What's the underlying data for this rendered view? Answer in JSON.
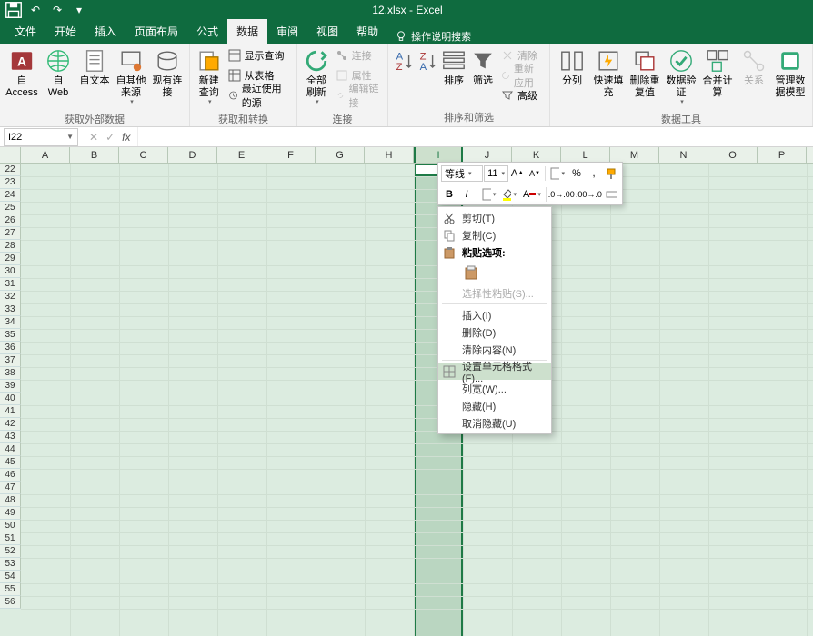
{
  "title": "12.xlsx  -  Excel",
  "qat": {
    "save": "💾",
    "undo": "↶",
    "redo": "↷"
  },
  "tabs": [
    "文件",
    "开始",
    "插入",
    "页面布局",
    "公式",
    "数据",
    "审阅",
    "视图",
    "帮助"
  ],
  "active_tab": "数据",
  "tellme": "操作说明搜索",
  "ribbon": {
    "groups": [
      {
        "label": "获取外部数据",
        "items": [
          "自 Access",
          "自 Web",
          "自文本",
          "自其他来源",
          "现有连接"
        ]
      },
      {
        "label": "获取和转换",
        "items_lg": [
          "新建查询"
        ],
        "items_sm": [
          "显示查询",
          "从表格",
          "最近使用的源"
        ]
      },
      {
        "label": "连接",
        "items_lg": [
          "全部刷新"
        ],
        "items_sm": [
          "连接",
          "属性",
          "编辑链接"
        ]
      },
      {
        "label": "排序和筛选",
        "items_lg": [
          "排序",
          "排序",
          "筛选"
        ],
        "items_sm": [
          "清除",
          "重新应用",
          "高级"
        ]
      },
      {
        "label": "数据工具",
        "items": [
          "分列",
          "快速填充",
          "删除重复值",
          "数据验证",
          "合并计算",
          "关系",
          "管理数据模型"
        ]
      }
    ]
  },
  "namebox": "I22",
  "columns": [
    "A",
    "B",
    "C",
    "D",
    "E",
    "F",
    "G",
    "H",
    "I",
    "J",
    "K",
    "L",
    "M",
    "N",
    "O",
    "P"
  ],
  "selected_column": "I",
  "first_row": 22,
  "last_row": 56,
  "mini_toolbar": {
    "font_name": "等线",
    "font_size": "11"
  },
  "context_menu": {
    "items": [
      {
        "label": "剪切(T)",
        "icon": "cut"
      },
      {
        "label": "复制(C)",
        "icon": "copy"
      },
      {
        "label": "粘贴选项:",
        "header": true,
        "icon": "paste"
      },
      {
        "paste_options": true
      },
      {
        "label": "选择性粘贴(S)...",
        "disabled": true
      },
      {
        "sep": true
      },
      {
        "label": "插入(I)"
      },
      {
        "label": "删除(D)"
      },
      {
        "label": "清除内容(N)"
      },
      {
        "sep": true
      },
      {
        "label": "设置单元格格式(F)...",
        "highlight": true,
        "icon": "format"
      },
      {
        "label": "列宽(W)..."
      },
      {
        "label": "隐藏(H)"
      },
      {
        "label": "取消隐藏(U)"
      }
    ]
  }
}
